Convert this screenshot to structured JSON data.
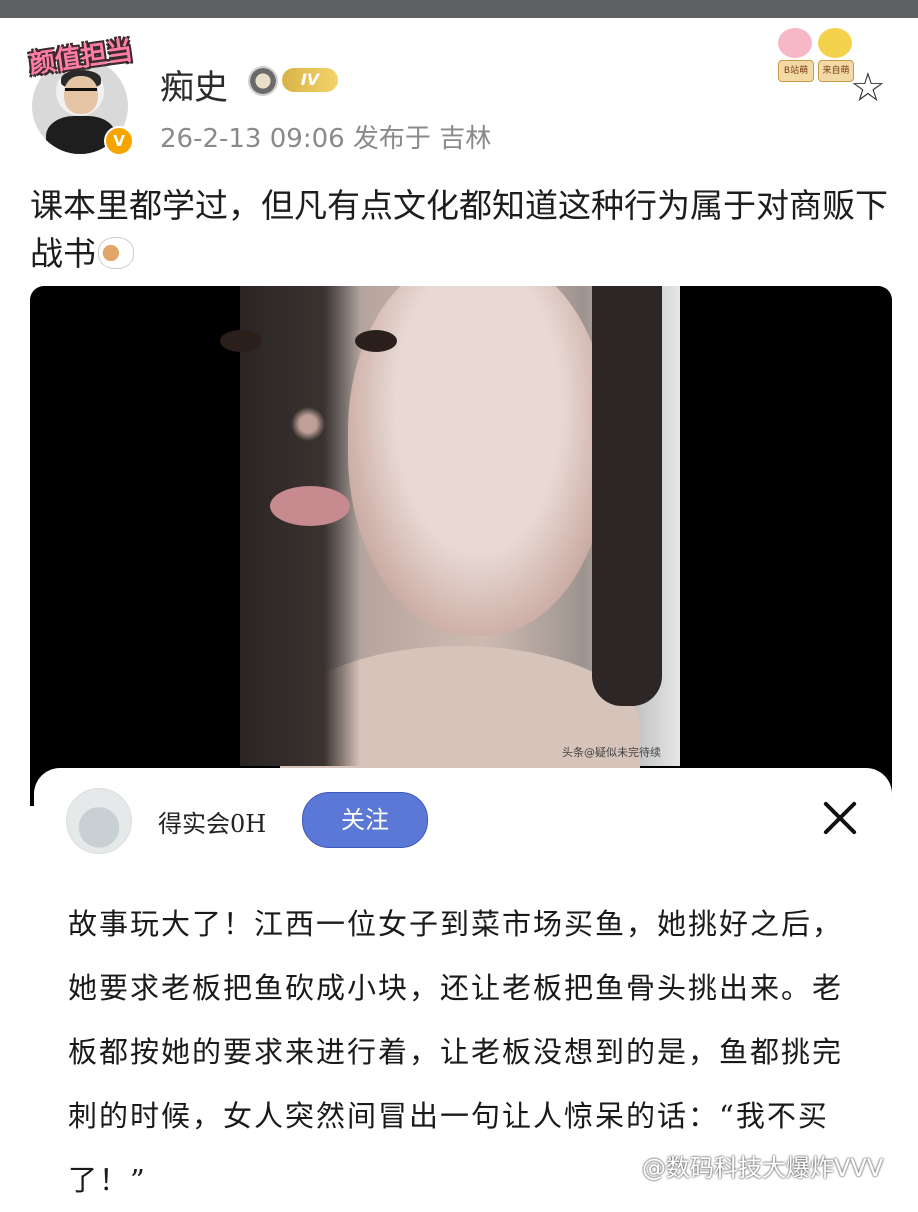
{
  "post": {
    "avatar_badge": "颜值担当",
    "verified_badge": "V",
    "username": "痴史",
    "level_badge": "IV",
    "meta": "26-2-13 09:06  发布于 吉林",
    "text": "课本里都学过，但凡有点文化都知道这种行为属于对商贩下战书"
  },
  "stickers": {
    "left_tag": "B站萌",
    "right_tag": "来自萌"
  },
  "icons": {
    "star": "star-icon",
    "close": "close-icon",
    "cat_emoji": "cat-emoji-icon"
  },
  "video": {
    "caption_watermark": "头条@疑似未完待续"
  },
  "sheet": {
    "account_name": "得实会0H",
    "follow_label": "关注",
    "story": "故事玩大了！江西一位女子到菜市场买鱼，她挑好之后，她要求老板把鱼砍成小块，还让老板把鱼骨头挑出来。老板都按她的要求来进行着，让老板没想到的是，鱼都挑完刺的时候，女人突然间冒出一句让人惊呆的话：“我不买了！”"
  },
  "watermark": "@数码科技大爆炸VVV"
}
